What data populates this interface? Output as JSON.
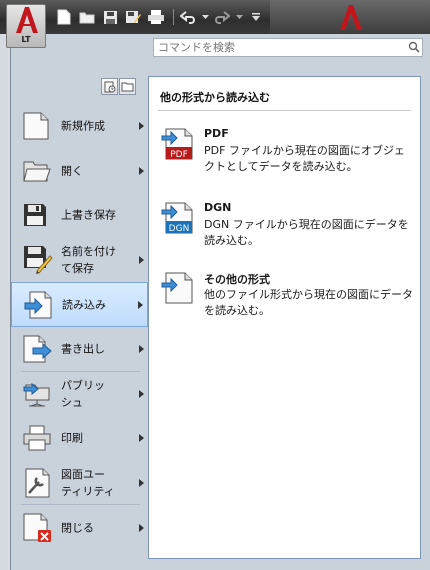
{
  "app": {
    "badge": "LT",
    "brand_color": "#c3161c"
  },
  "quick_access": [
    {
      "name": "new-icon"
    },
    {
      "name": "open-folder-icon"
    },
    {
      "name": "save-icon"
    },
    {
      "name": "save-as-icon"
    },
    {
      "name": "print-icon"
    },
    {
      "name": "undo-icon"
    },
    {
      "name": "redo-icon"
    },
    {
      "name": "customize-dropdown-icon"
    }
  ],
  "search": {
    "placeholder": "コマンドを検索"
  },
  "commands": [
    {
      "label": "新規作成",
      "icon": "new-document-icon",
      "has_submenu": true
    },
    {
      "label": "開く",
      "icon": "open-folder-icon",
      "has_submenu": true
    },
    {
      "label": "上書き保存",
      "icon": "save-icon",
      "has_submenu": false
    },
    {
      "label": "名前を付け\nて保存",
      "icon": "save-as-icon",
      "has_submenu": true
    },
    {
      "label": "読み込み",
      "icon": "import-icon",
      "has_submenu": true,
      "selected": true
    },
    {
      "label": "書き出し",
      "icon": "export-icon",
      "has_submenu": true
    },
    {
      "label": "パブリッ\nシュ",
      "icon": "publish-icon",
      "has_submenu": true
    },
    {
      "label": "印刷",
      "icon": "print-icon",
      "has_submenu": true
    },
    {
      "label": "図面ユー\nティリティ",
      "icon": "drawing-utilities-icon",
      "has_submenu": true
    },
    {
      "label": "閉じる",
      "icon": "close-document-icon",
      "has_submenu": true
    }
  ],
  "submenu": {
    "title": "他の形式から読み込む",
    "items": [
      {
        "name": "PDF",
        "description": "PDF ファイルから現在の図面にオブジェクトとしてデータを読み込む。",
        "icon": "pdf-import-icon",
        "icon_label": "PDF",
        "icon_color": "#b71c1c"
      },
      {
        "name": "DGN",
        "description": "DGN ファイルから現在の図面にデータを読み込む。",
        "icon": "dgn-import-icon",
        "icon_label": "DGN",
        "icon_color": "#1b73b8"
      },
      {
        "name": "その他の形式",
        "description": "他のファイル形式から現在の図面にデータを読み込む。",
        "icon": "other-formats-import-icon"
      }
    ]
  }
}
